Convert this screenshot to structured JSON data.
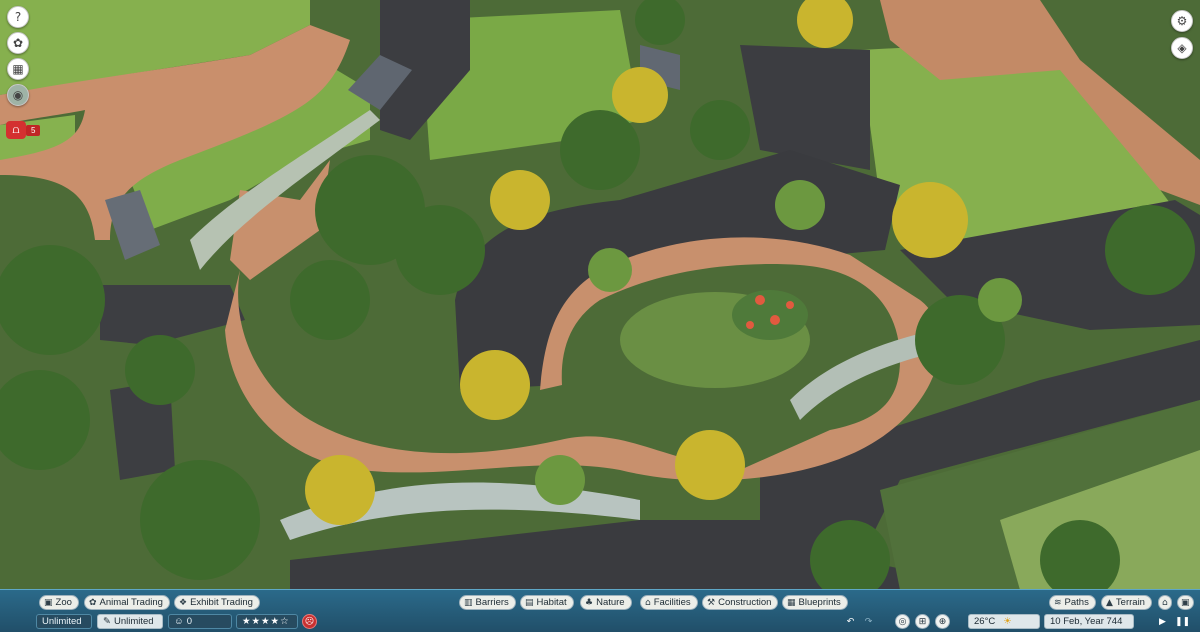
{
  "left_toolbar": {
    "help_icon": "?",
    "notification_count": "5"
  },
  "bottom_bar": {
    "left_tabs": [
      {
        "label": "Zoo",
        "icon": "zoo-icon"
      },
      {
        "label": "Animal Trading",
        "icon": "paw-icon"
      },
      {
        "label": "Exhibit Trading",
        "icon": "exhibit-icon"
      }
    ],
    "center_tabs": [
      {
        "label": "Barriers",
        "icon": "barrier-icon"
      },
      {
        "label": "Habitat",
        "icon": "habitat-icon"
      },
      {
        "label": "Nature",
        "icon": "nature-icon"
      },
      {
        "label": "Facilities",
        "icon": "facilities-icon"
      },
      {
        "label": "Construction",
        "icon": "construction-icon"
      },
      {
        "label": "Blueprints",
        "icon": "blueprints-icon"
      }
    ],
    "right_tabs": [
      {
        "label": "Paths",
        "icon": "paths-icon"
      },
      {
        "label": "Terrain",
        "icon": "terrain-icon"
      }
    ],
    "money": "Unlimited",
    "research": "Unlimited",
    "guests": "0",
    "rating_stars": 4,
    "temperature": "26°C",
    "date": "10 Feb, Year 744"
  },
  "colors": {
    "bar_bg": "#2b6a8a",
    "grass": "#7fae4a",
    "path_brick": "#c98f6c",
    "path_asphalt": "#3b3c40",
    "red_alert": "#d43030"
  }
}
